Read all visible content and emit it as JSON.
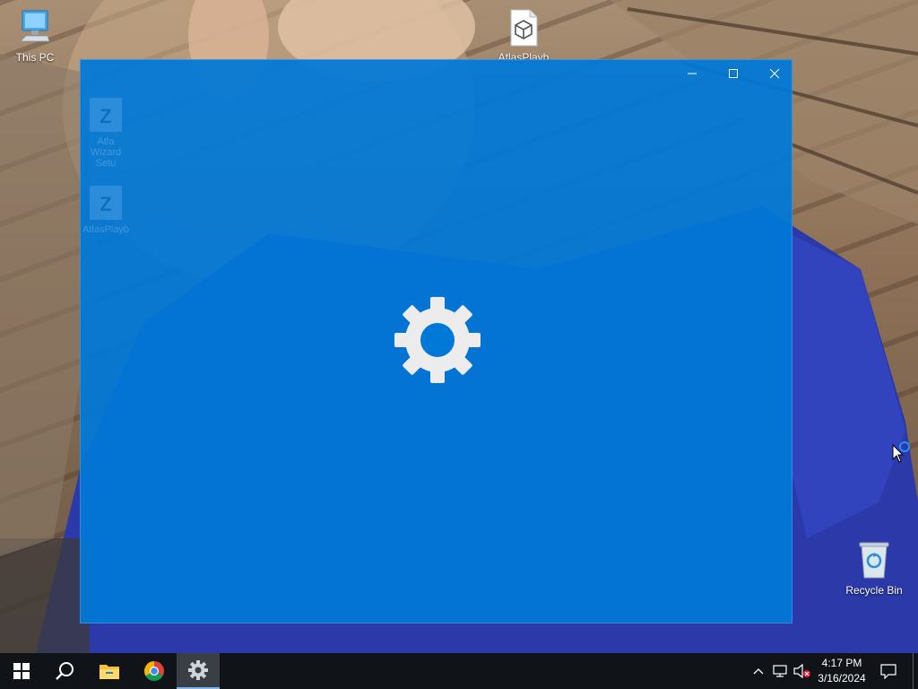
{
  "desktop": {
    "icons": [
      {
        "label": "This PC",
        "icon": "computer-icon"
      },
      {
        "label": "AtlasPlayb",
        "icon": "atlas-file-icon"
      },
      {
        "label": "Recycle Bin",
        "icon": "recycle-bin-icon"
      }
    ],
    "ghost_icons": [
      {
        "label": "Atla Wizard Setu",
        "icon": "zip-archive-icon"
      },
      {
        "label": "AtlasPlayb",
        "icon": "zip-archive-icon"
      }
    ]
  },
  "splash": {
    "icon": "settings-gear-icon",
    "background_color": "#0078d7",
    "controls": [
      "minimize-icon",
      "maximize-icon",
      "close-icon"
    ]
  },
  "taskbar": {
    "buttons": [
      "windows-start-icon",
      "search-icon",
      "file-explorer-icon",
      "chrome-icon",
      "settings-icon"
    ],
    "active": "settings-icon",
    "tray": [
      "show-hidden-icons-icon",
      "network-icon",
      "volume-muted-icon",
      "action-center-icon"
    ],
    "time": "4:17 PM",
    "date": "3/16/2024"
  }
}
